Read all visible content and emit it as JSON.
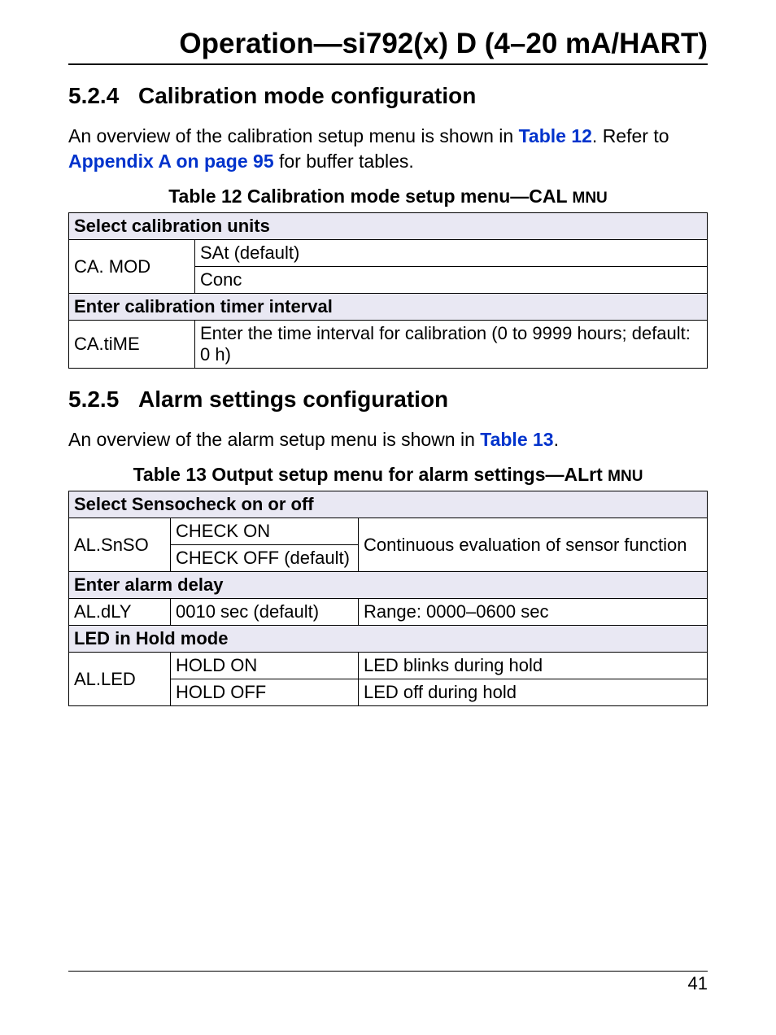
{
  "page_title": "Operation—si792(x) D (4–20 mA/HART)",
  "page_number": "41",
  "section_524": {
    "number": "5.2.4",
    "title": "Calibration mode configuration",
    "body_prefix": "An overview of the calibration setup menu is shown in ",
    "link1": "Table 12",
    "body_mid": ". Refer to ",
    "link2": "Appendix A on page 95",
    "body_suffix": " for buffer tables."
  },
  "table12": {
    "caption_main": "Table 12   Calibration mode setup menu—CAL ",
    "caption_small": "MNU",
    "row1_header": "Select calibration units",
    "row2_c1": "CA. MOD",
    "row2_c2a": "SAt (default)",
    "row2_c2b": "Conc",
    "row3_header": "Enter calibration timer interval",
    "row4_c1": "CA.tiME",
    "row4_c2": "Enter the time interval for calibration (0 to 9999 hours; default: 0 h)"
  },
  "section_525": {
    "number": "5.2.5",
    "title": "Alarm settings configuration",
    "body_prefix": "An overview of the alarm setup menu is shown in ",
    "link1": "Table 13",
    "body_suffix": "."
  },
  "table13": {
    "caption_main": "Table 13   Output setup menu for alarm settings—ALrt ",
    "caption_small": "MNU",
    "r1_header": "Select Sensocheck on or off",
    "r2_c1": "AL.SnSO",
    "r2_c2a": "CHECK ON",
    "r2_c2b": "CHECK OFF (default)",
    "r2_c3": "Continuous evaluation of sensor function",
    "r3_header": "Enter alarm delay",
    "r4_c1": "AL.dLY",
    "r4_c2": "0010 sec (default)",
    "r4_c3": "Range: 0000–0600 sec",
    "r5_header": "LED in Hold mode",
    "r6_c1": "AL.LED",
    "r6_c2a": "HOLD ON",
    "r6_c3a": "LED blinks during hold",
    "r6_c2b": "HOLD OFF",
    "r6_c3b": "LED off during hold"
  }
}
